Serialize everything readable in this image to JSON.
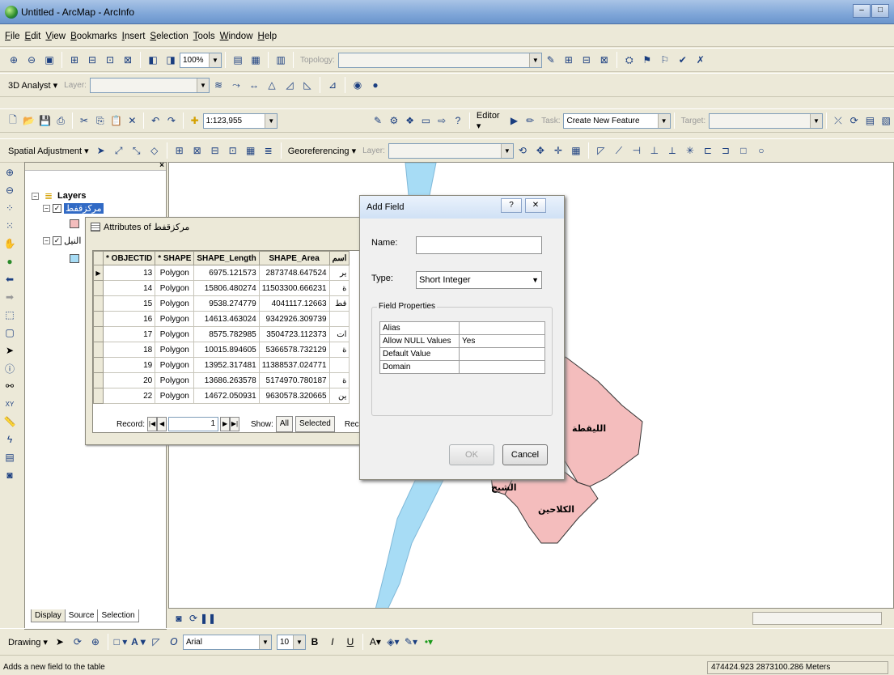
{
  "window": {
    "title": "Untitled - ArcMap - ArcInfo",
    "min": "–",
    "max": "□"
  },
  "menu": [
    "File",
    "Edit",
    "View",
    "Bookmarks",
    "Insert",
    "Selection",
    "Tools",
    "Window",
    "Help"
  ],
  "toolbar1": {
    "zoom": "100%",
    "topology_label": "Topology:"
  },
  "toolbar2": {
    "analyst": "3D Analyst ▾",
    "layer_label": "Layer:"
  },
  "toolbar3": {
    "scale": "1:123,955",
    "editor": "Editor ▾",
    "task_label": "Task:",
    "task_value": "Create New Feature",
    "target_label": "Target:"
  },
  "toolbar4": {
    "spatial_adjustment": "Spatial Adjustment ▾",
    "georeferencing": "Georeferencing ▾",
    "layer_label": "Layer:"
  },
  "toc": {
    "root": "Layers",
    "layer1": "مركزقفط",
    "layer2": "النيل",
    "tabs": [
      "Display",
      "Source",
      "Selection"
    ]
  },
  "attributes": {
    "title": "Attributes of مركزقفط",
    "columns": [
      "* OBJECTID",
      "* SHAPE",
      "SHAPE_Length",
      "SHAPE_Area",
      "اسم"
    ],
    "rows": [
      [
        "13",
        "Polygon",
        "6975.121573",
        "2873748.647524",
        "ير"
      ],
      [
        "14",
        "Polygon",
        "15806.480274",
        "11503300.666231",
        "ة"
      ],
      [
        "15",
        "Polygon",
        "9538.274779",
        "4041117.12663",
        "قط"
      ],
      [
        "16",
        "Polygon",
        "14613.463024",
        "9342926.309739",
        ""
      ],
      [
        "17",
        "Polygon",
        "8575.782985",
        "3504723.112373",
        "ات"
      ],
      [
        "18",
        "Polygon",
        "10015.894605",
        "5366578.732129",
        "ة"
      ],
      [
        "19",
        "Polygon",
        "13952.317481",
        "11388537.024771",
        ""
      ],
      [
        "20",
        "Polygon",
        "13686.263578",
        "5174970.780187",
        "ة"
      ],
      [
        "22",
        "Polygon",
        "14672.050931",
        "9630578.320665",
        "ين"
      ]
    ],
    "record_label": "Record:",
    "record_value": "1",
    "show_label": "Show:",
    "all_btn": "All",
    "selected_btn": "Selected",
    "records_label": "Rec"
  },
  "dialog": {
    "title": "Add Field",
    "help": "?",
    "close": "✕",
    "name_label": "Name:",
    "name_value": "",
    "type_label": "Type:",
    "type_value": "Short Integer",
    "props_legend": "Field Properties",
    "props": [
      [
        "Alias",
        ""
      ],
      [
        "Allow NULL Values",
        "Yes"
      ],
      [
        "Default Value",
        ""
      ],
      [
        "Domain",
        ""
      ]
    ],
    "ok": "OK",
    "cancel": "Cancel"
  },
  "map_labels": {
    "l1": "الليقطة",
    "l2": "الكلاحين",
    "l3": "الشيخ"
  },
  "drawing": {
    "label": "Drawing ▾",
    "font": "Arial",
    "size": "10"
  },
  "status": {
    "message": "Adds a new field to the table",
    "coords": "474424.923  2873100.286 Meters"
  },
  "colors": {
    "river": "#a7dcf5",
    "polygon": "#f4bdbd",
    "highlight": "#316ac5"
  }
}
